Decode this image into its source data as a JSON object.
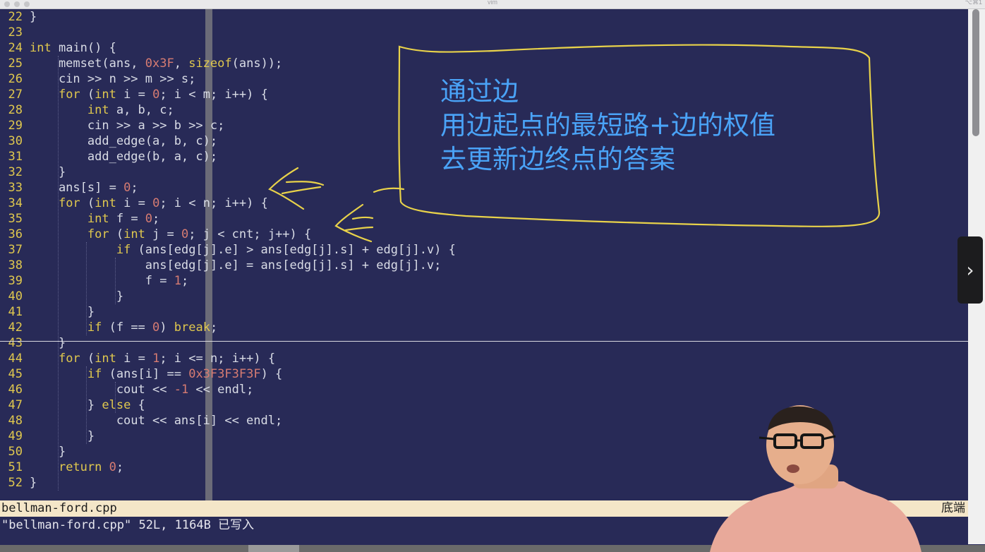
{
  "window": {
    "title": "vim",
    "shortcut": "⌥⌘1"
  },
  "editor": {
    "lines": [
      {
        "n": "22",
        "segs": [
          [
            "}",
            ""
          ]
        ]
      },
      {
        "n": "23",
        "segs": []
      },
      {
        "n": "24",
        "segs": [
          [
            "int",
            "kw"
          ],
          [
            " main() {",
            ""
          ]
        ]
      },
      {
        "n": "25",
        "segs": [
          [
            "    memset(ans, ",
            ""
          ],
          [
            "0x3F",
            "num"
          ],
          [
            ", ",
            ""
          ],
          [
            "sizeof",
            "kw"
          ],
          [
            "(ans));",
            ""
          ]
        ]
      },
      {
        "n": "26",
        "segs": [
          [
            "    cin >> n >> m >> s;",
            ""
          ]
        ]
      },
      {
        "n": "27",
        "segs": [
          [
            "    ",
            ""
          ],
          [
            "for",
            "kw"
          ],
          [
            " (",
            ""
          ],
          [
            "int",
            "kw"
          ],
          [
            " i = ",
            ""
          ],
          [
            "0",
            "num"
          ],
          [
            "; i < m; i++) {",
            ""
          ]
        ]
      },
      {
        "n": "28",
        "segs": [
          [
            "        ",
            ""
          ],
          [
            "int",
            "kw"
          ],
          [
            " a, b, c;",
            ""
          ]
        ]
      },
      {
        "n": "29",
        "segs": [
          [
            "        cin >> a >> b >> c;",
            ""
          ]
        ]
      },
      {
        "n": "30",
        "segs": [
          [
            "        add_edge(a, b, c);",
            ""
          ]
        ]
      },
      {
        "n": "31",
        "segs": [
          [
            "        add_edge(b, a, c);",
            ""
          ]
        ]
      },
      {
        "n": "32",
        "segs": [
          [
            "    }",
            ""
          ]
        ]
      },
      {
        "n": "33",
        "segs": [
          [
            "    ans[s] = ",
            ""
          ],
          [
            "0",
            "num"
          ],
          [
            ";",
            ""
          ]
        ]
      },
      {
        "n": "34",
        "segs": [
          [
            "    ",
            ""
          ],
          [
            "for",
            "kw"
          ],
          [
            " (",
            ""
          ],
          [
            "int",
            "kw"
          ],
          [
            " i = ",
            ""
          ],
          [
            "0",
            "num"
          ],
          [
            "; i < n; i++) {",
            ""
          ]
        ]
      },
      {
        "n": "35",
        "segs": [
          [
            "        ",
            ""
          ],
          [
            "int",
            "kw"
          ],
          [
            " f = ",
            ""
          ],
          [
            "0",
            "num"
          ],
          [
            ";",
            ""
          ]
        ]
      },
      {
        "n": "36",
        "segs": [
          [
            "        ",
            ""
          ],
          [
            "for",
            "kw"
          ],
          [
            " (",
            ""
          ],
          [
            "int",
            "kw"
          ],
          [
            " j = ",
            ""
          ],
          [
            "0",
            "num"
          ],
          [
            "; j < cnt; j++) {",
            ""
          ]
        ]
      },
      {
        "n": "37",
        "segs": [
          [
            "            ",
            ""
          ],
          [
            "if",
            "kw"
          ],
          [
            " (ans[edg[j].e] > ans[edg[j].s] + edg[j].v) {",
            ""
          ]
        ]
      },
      {
        "n": "38",
        "segs": [
          [
            "                ans[edg[j].e] = ans[edg[j].s] + edg[j].v;",
            ""
          ]
        ]
      },
      {
        "n": "39",
        "segs": [
          [
            "                f = ",
            ""
          ],
          [
            "1",
            "num"
          ],
          [
            ";",
            ""
          ]
        ]
      },
      {
        "n": "40",
        "segs": [
          [
            "            }",
            ""
          ]
        ]
      },
      {
        "n": "41",
        "segs": [
          [
            "        }",
            ""
          ]
        ]
      },
      {
        "n": "42",
        "segs": [
          [
            "        ",
            ""
          ],
          [
            "if",
            "kw"
          ],
          [
            " (f == ",
            ""
          ],
          [
            "0",
            "num"
          ],
          [
            ") ",
            ""
          ],
          [
            "break",
            "kw"
          ],
          [
            ";",
            ""
          ]
        ]
      },
      {
        "n": "43",
        "segs": [
          [
            "    }",
            ""
          ]
        ]
      },
      {
        "n": "44",
        "segs": [
          [
            "    ",
            ""
          ],
          [
            "for",
            "kw"
          ],
          [
            " (",
            ""
          ],
          [
            "int",
            "kw"
          ],
          [
            " i = ",
            ""
          ],
          [
            "1",
            "num"
          ],
          [
            "; i <= n; i++) {",
            ""
          ]
        ]
      },
      {
        "n": "45",
        "segs": [
          [
            "        ",
            ""
          ],
          [
            "if",
            "kw"
          ],
          [
            " (ans[i] == ",
            ""
          ],
          [
            "0x3F3F3F3F",
            "num"
          ],
          [
            ") {",
            ""
          ]
        ]
      },
      {
        "n": "46",
        "segs": [
          [
            "            cout << ",
            ""
          ],
          [
            "-1",
            "num"
          ],
          [
            " << endl;",
            ""
          ]
        ]
      },
      {
        "n": "47",
        "segs": [
          [
            "        } ",
            ""
          ],
          [
            "else",
            "kw"
          ],
          [
            " {",
            ""
          ]
        ]
      },
      {
        "n": "48",
        "segs": [
          [
            "            cout << ans[i] << endl;",
            ""
          ]
        ]
      },
      {
        "n": "49",
        "segs": [
          [
            "        }",
            ""
          ]
        ]
      },
      {
        "n": "50",
        "segs": [
          [
            "    }",
            ""
          ]
        ]
      },
      {
        "n": "51",
        "segs": [
          [
            "    ",
            ""
          ],
          [
            "return",
            "kw"
          ],
          [
            " ",
            ""
          ],
          [
            "0",
            "num"
          ],
          [
            ";",
            ""
          ]
        ]
      },
      {
        "n": "52",
        "segs": [
          [
            "}",
            ""
          ]
        ]
      }
    ]
  },
  "statusline": {
    "filename": "bellman-ford.cpp",
    "position": "底端"
  },
  "cmdline": {
    "message": "\"bellman-ford.cpp\" 52L, 1164B 已写入"
  },
  "annotation": {
    "line1": "通过边",
    "line2": "用边起点的最短路+边的权值",
    "line3": "去更新边终点的答案",
    "ink_color": "#e8d24a",
    "text_color": "#4aa3f7"
  },
  "overlay": {
    "next_label": "›"
  },
  "colors": {
    "background": "#282a57",
    "keyword": "#e0c84e",
    "number": "#d77c72",
    "text": "#d9dce6",
    "statusline": "#f4e6c8"
  }
}
